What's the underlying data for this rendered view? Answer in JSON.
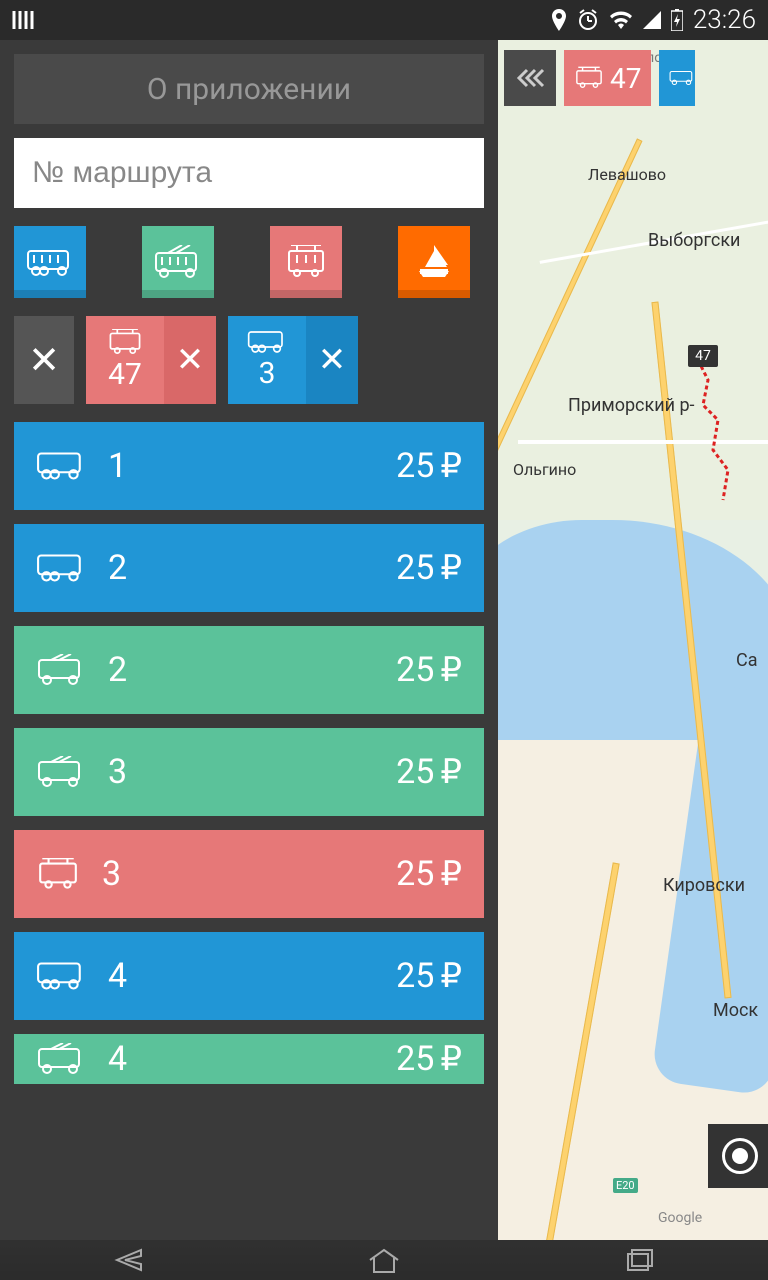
{
  "status": {
    "time": "23:26"
  },
  "sidebar": {
    "about_label": "О приложении",
    "search_placeholder": "№ маршрута",
    "filters": [
      {
        "type": "bus",
        "icon": "bus-icon"
      },
      {
        "type": "trolley",
        "icon": "trolleybus-icon"
      },
      {
        "type": "tram",
        "icon": "tram-icon"
      },
      {
        "type": "boat",
        "icon": "boat-icon"
      }
    ],
    "chips": [
      {
        "type": "tram",
        "number": "47"
      },
      {
        "type": "bus",
        "number": "3"
      }
    ],
    "routes": [
      {
        "type": "bus",
        "number": "1",
        "price": "25"
      },
      {
        "type": "bus",
        "number": "2",
        "price": "25"
      },
      {
        "type": "trolley",
        "number": "2",
        "price": "25"
      },
      {
        "type": "trolley",
        "number": "3",
        "price": "25"
      },
      {
        "type": "tram",
        "number": "3",
        "price": "25"
      },
      {
        "type": "bus",
        "number": "4",
        "price": "25"
      },
      {
        "type": "trolley",
        "number": "4",
        "price": "25"
      }
    ],
    "currency": "₽"
  },
  "map": {
    "active_chip": {
      "type": "tram",
      "number": "47"
    },
    "marker_label": "47",
    "labels": {
      "levashovo": "Левашово",
      "vyborgsky": "Выборгски",
      "primorsky": "Приморский р-",
      "olgino": "Ольгино",
      "sa": "Са",
      "kirovsky": "Кировски",
      "mosk": "Моск",
      "google": "Google",
      "e20": "E20",
      "sertolovo": "Сертолово"
    }
  },
  "colors": {
    "bus": "#2196d6",
    "trolley": "#5bc29a",
    "tram": "#e67878",
    "boat": "#ff6b00"
  }
}
